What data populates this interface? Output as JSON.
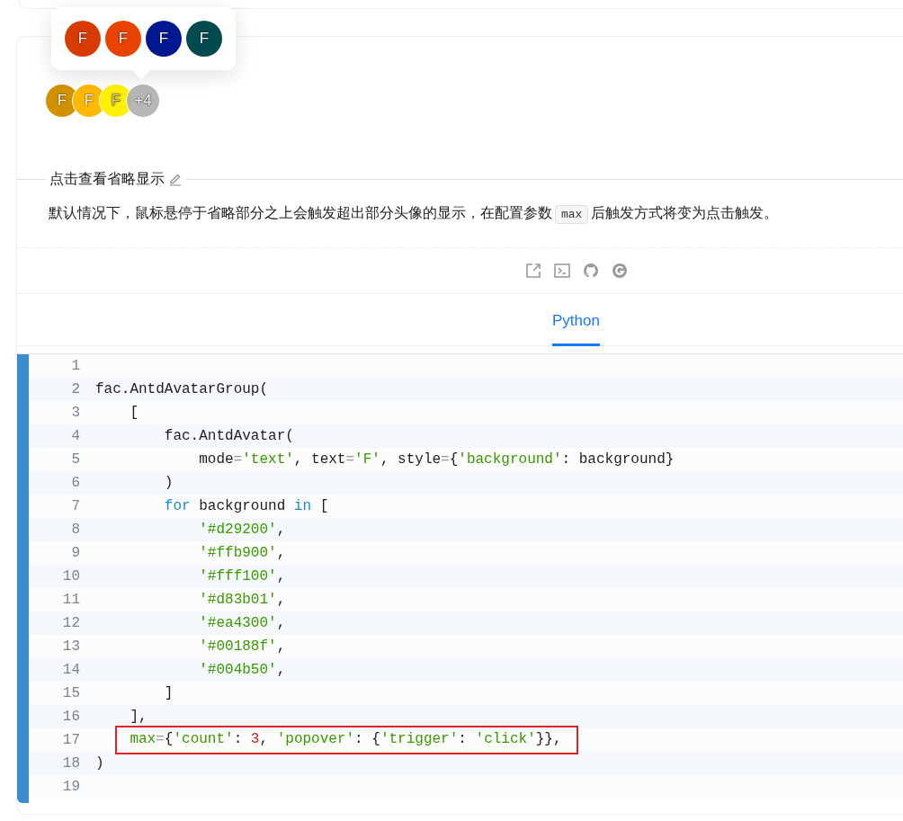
{
  "popover": {
    "avatars": [
      {
        "text": "F",
        "color": "#d83b01"
      },
      {
        "text": "F",
        "color": "#ea4300"
      },
      {
        "text": "F",
        "color": "#00188f"
      },
      {
        "text": "F",
        "color": "#004b50"
      }
    ]
  },
  "avatar_group": {
    "avatars": [
      {
        "text": "F",
        "color": "#d29200"
      },
      {
        "text": "F",
        "color": "#ffb900"
      },
      {
        "text": "F",
        "color": "#fff100"
      }
    ],
    "overflow": "+4"
  },
  "section": {
    "title": "点击查看省略显示",
    "description": {
      "before": "默认情况下，鼠标悬停于省略部分之上会触发超出部分头像的显示，在配置参数",
      "code": "max",
      "after": "后触发方式将变为点击触发。"
    }
  },
  "tabs": [
    {
      "label": "Python",
      "selected": true
    }
  ],
  "code": {
    "lines": [
      {
        "number": "1",
        "highlighted": false
      },
      {
        "number": "2",
        "highlighted": false,
        "tokens": [
          {
            "text": "fac.AntdAvatarGroup(",
            "kind": "plain"
          }
        ],
        "children": [
          {
            "number": "3",
            "highlighted": false,
            "tokens": [
              {
                "text": "[",
                "kind": "plain"
              }
            ],
            "children": [
              {
                "number": "4",
                "highlighted": false,
                "tokens": [
                  {
                    "text": "fac.AntdAvatar(",
                    "kind": "plain"
                  }
                ],
                "children": [
                  {
                    "number": "5",
                    "highlighted": false,
                    "tokens": [
                      {
                        "text": "mode",
                        "kind": "plain"
                      },
                      {
                        "text": "=",
                        "kind": "operator"
                      },
                      {
                        "text": "'text'",
                        "kind": "string"
                      },
                      {
                        "text": ", text",
                        "kind": "plain"
                      },
                      {
                        "text": "=",
                        "kind": "operator"
                      },
                      {
                        "text": "'F'",
                        "kind": "string"
                      },
                      {
                        "text": ", style",
                        "kind": "plain"
                      },
                      {
                        "text": "=",
                        "kind": "operator"
                      },
                      {
                        "text": "{",
                        "kind": "plain"
                      },
                      {
                        "text": "'background'",
                        "kind": "string"
                      },
                      {
                        "text": ": background}",
                        "kind": "plain"
                      }
                    ]
                  }
                ]
              },
              {
                "number": "6",
                "highlighted": false,
                "tokens": [
                  {
                    "text": ")",
                    "kind": "plain"
                  }
                ]
              },
              {
                "number": "7",
                "highlighted": false,
                "tokens": [
                  {
                    "text": "for",
                    "kind": "keyword"
                  },
                  {
                    "text": " background ",
                    "kind": "plain"
                  },
                  {
                    "text": "in",
                    "kind": "keyword"
                  },
                  {
                    "text": " [",
                    "kind": "plain"
                  }
                ],
                "children": [
                  {
                    "number": "8",
                    "highlighted": false,
                    "tokens": [
                      {
                        "text": "'#d29200'",
                        "kind": "string"
                      },
                      {
                        "text": ",",
                        "kind": "plain"
                      }
                    ]
                  },
                  {
                    "number": "9",
                    "highlighted": false,
                    "tokens": [
                      {
                        "text": "'#ffb900'",
                        "kind": "string"
                      },
                      {
                        "text": ",",
                        "kind": "plain"
                      }
                    ]
                  },
                  {
                    "number": "10",
                    "highlighted": false,
                    "tokens": [
                      {
                        "text": "'#fff100'",
                        "kind": "string"
                      },
                      {
                        "text": ",",
                        "kind": "plain"
                      }
                    ]
                  },
                  {
                    "number": "11",
                    "highlighted": false,
                    "tokens": [
                      {
                        "text": "'#d83b01'",
                        "kind": "string"
                      },
                      {
                        "text": ",",
                        "kind": "plain"
                      }
                    ]
                  },
                  {
                    "number": "12",
                    "highlighted": false,
                    "tokens": [
                      {
                        "text": "'#ea4300'",
                        "kind": "string"
                      },
                      {
                        "text": ",",
                        "kind": "plain"
                      }
                    ]
                  },
                  {
                    "number": "13",
                    "highlighted": false,
                    "tokens": [
                      {
                        "text": "'#00188f'",
                        "kind": "string"
                      },
                      {
                        "text": ",",
                        "kind": "plain"
                      }
                    ]
                  },
                  {
                    "number": "14",
                    "highlighted": false,
                    "tokens": [
                      {
                        "text": "'#004b50'",
                        "kind": "string"
                      },
                      {
                        "text": ",",
                        "kind": "plain"
                      }
                    ]
                  }
                ]
              },
              {
                "number": "15",
                "highlighted": false,
                "tokens": [
                  {
                    "text": "]",
                    "kind": "plain"
                  }
                ]
              }
            ]
          },
          {
            "number": "16",
            "highlighted": false,
            "tokens": [
              {
                "text": "],",
                "kind": "plain"
              }
            ]
          },
          {
            "number": "17",
            "highlighted": true,
            "tokens": [
              {
                "text": "max",
                "kind": "param"
              },
              {
                "text": "=",
                "kind": "operator"
              },
              {
                "text": "{",
                "kind": "plain"
              },
              {
                "text": "'count'",
                "kind": "string"
              },
              {
                "text": ": ",
                "kind": "plain"
              },
              {
                "text": "3",
                "kind": "number"
              },
              {
                "text": ", ",
                "kind": "plain"
              },
              {
                "text": "'popover'",
                "kind": "string"
              },
              {
                "text": ": {",
                "kind": "plain"
              },
              {
                "text": "'trigger'",
                "kind": "string"
              },
              {
                "text": ": ",
                "kind": "plain"
              },
              {
                "text": "'click'",
                "kind": "string"
              },
              {
                "text": "}},",
                "kind": "plain"
              }
            ]
          }
        ]
      },
      {
        "number": "18",
        "highlighted": false,
        "tokens": [
          {
            "text": ")",
            "kind": "plain"
          }
        ]
      },
      {
        "number": "19",
        "highlighted": false
      }
    ]
  }
}
